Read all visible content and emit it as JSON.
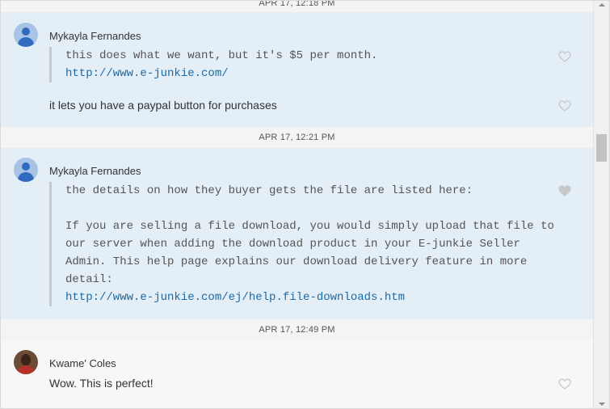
{
  "date_dividers": [
    "APR 17, 12:18 PM",
    "APR 17, 12:21 PM",
    "APR 17, 12:49 PM"
  ],
  "messages": [
    {
      "sender": "Mykayla Fernandes",
      "quote_text": "this does what we want, but it's $5 per month.",
      "quote_link": "http://www.e-junkie.com/",
      "text": "it lets you have a paypal button for purchases"
    },
    {
      "sender": "Mykayla Fernandes",
      "quote_line1": "the details on how they buyer gets the file are listed here:",
      "quote_body": "If you are selling a file download, you would simply upload that file to\nour server when adding the download product in your E-junkie Seller\nAdmin. This help page explains our download delivery feature in more\ndetail:",
      "quote_link": "http://www.e-junkie.com/ej/help.file-downloads.htm"
    },
    {
      "sender": "Kwame' Coles",
      "text": "Wow. This is perfect!"
    }
  ],
  "icons": {
    "heart": "heart-icon",
    "avatar_default": "person-icon"
  },
  "colors": {
    "bubble_bg": "#e4eef6",
    "link": "#1b6aa6",
    "avatar_blue": "#2f6cc0"
  }
}
